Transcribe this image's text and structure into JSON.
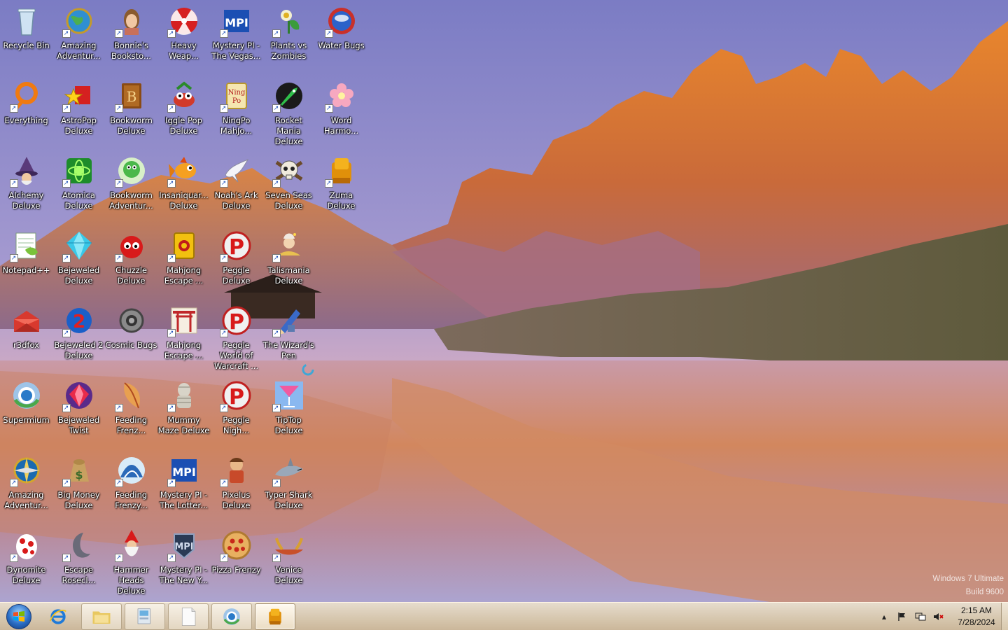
{
  "desktop": {
    "icons": [
      {
        "label": "Recycle Bin",
        "icon": "recycle-bin-icon",
        "shortcut": false
      },
      {
        "label": "Amazing Adventur...",
        "icon": "globe-icon",
        "shortcut": true
      },
      {
        "label": "Bonnie's Booksto...",
        "icon": "character-icon",
        "shortcut": true
      },
      {
        "label": "Heavy Weap...",
        "icon": "radiation-icon",
        "shortcut": true
      },
      {
        "label": "Mystery PI - The Vegas...",
        "icon": "mpi-icon",
        "shortcut": true
      },
      {
        "label": "Plants vs Zombies",
        "icon": "plant-icon",
        "shortcut": true
      },
      {
        "label": "Water Bugs",
        "icon": "orb-icon",
        "shortcut": true
      },
      {
        "label": "Everything",
        "icon": "magnifier-icon",
        "shortcut": true
      },
      {
        "label": "AstroPop Deluxe",
        "icon": "star-icon",
        "shortcut": true
      },
      {
        "label": "Bookworm Deluxe",
        "icon": "book-icon",
        "shortcut": true
      },
      {
        "label": "Iggle Pop Deluxe",
        "icon": "creature-icon",
        "shortcut": true
      },
      {
        "label": "NingPo MahJo...",
        "icon": "mahjong-tile-icon",
        "shortcut": true
      },
      {
        "label": "Rocket Mania Deluxe",
        "icon": "rocket-icon",
        "shortcut": true
      },
      {
        "label": "Word Harmo...",
        "icon": "flower-icon",
        "shortcut": true
      },
      {
        "label": "Alchemy Deluxe",
        "icon": "wizard-icon",
        "shortcut": true
      },
      {
        "label": "Atomica Deluxe",
        "icon": "atom-icon",
        "shortcut": true
      },
      {
        "label": "Bookworm Adventur...",
        "icon": "worm-icon",
        "shortcut": true
      },
      {
        "label": "Insaniquar... Deluxe",
        "icon": "fish-icon",
        "shortcut": true
      },
      {
        "label": "Noah's Ark Deluxe",
        "icon": "dove-icon",
        "shortcut": true
      },
      {
        "label": "Seven Seas Deluxe",
        "icon": "skull-icon",
        "shortcut": true
      },
      {
        "label": "Zuma Deluxe",
        "icon": "frog-idol-icon",
        "shortcut": true
      },
      {
        "label": "Notepad++",
        "icon": "notepad-icon",
        "shortcut": true
      },
      {
        "label": "Bejeweled Deluxe",
        "icon": "gem-icon",
        "shortcut": true
      },
      {
        "label": "Chuzzle Deluxe",
        "icon": "chuzzle-icon",
        "shortcut": true
      },
      {
        "label": "Mahjong Escape ...",
        "icon": "scroll-icon",
        "shortcut": true
      },
      {
        "label": "Peggle Deluxe",
        "icon": "peggle-icon",
        "shortcut": true
      },
      {
        "label": "Talismania Deluxe",
        "icon": "genie-icon",
        "shortcut": true
      },
      {
        "label": "r3dfox",
        "icon": "fox-icon",
        "shortcut": false
      },
      {
        "label": "Bejeweled 2 Deluxe",
        "icon": "gem2-icon",
        "shortcut": true
      },
      {
        "label": "Cosmic Bugs",
        "icon": "bug-icon",
        "shortcut": false
      },
      {
        "label": "Mahjong Escape ...",
        "icon": "torii-icon",
        "shortcut": true
      },
      {
        "label": "Peggle World of Warcraft ...",
        "icon": "peggle-icon",
        "shortcut": true
      },
      {
        "label": "The Wizard's Pen",
        "icon": "pen-icon",
        "shortcut": true
      },
      {
        "label": "Supermium",
        "icon": "browser-icon",
        "shortcut": false
      },
      {
        "label": "Bejeweled Twist",
        "icon": "twist-icon",
        "shortcut": true
      },
      {
        "label": "Feeding Frenz...",
        "icon": "feeding-fish-icon",
        "shortcut": true
      },
      {
        "label": "Mummy Maze Deluxe",
        "icon": "mummy-icon",
        "shortcut": true
      },
      {
        "label": "Peggle Nigh...",
        "icon": "peggle-icon",
        "shortcut": true
      },
      {
        "label": "TipTop Deluxe",
        "icon": "cocktail-icon",
        "shortcut": true
      },
      {
        "label": "Amazing Adventur...",
        "icon": "compass-icon",
        "shortcut": true
      },
      {
        "label": "Big Money Deluxe",
        "icon": "money-bag-icon",
        "shortcut": true
      },
      {
        "label": "Feeding Frenzy...",
        "icon": "shark-fin-icon",
        "shortcut": true
      },
      {
        "label": "Mystery PI - The Lotter...",
        "icon": "mpi-icon",
        "shortcut": true
      },
      {
        "label": "Pixelus Deluxe",
        "icon": "explorer-icon",
        "shortcut": true
      },
      {
        "label": "Typer Shark Deluxe",
        "icon": "shark-icon",
        "shortcut": true
      },
      {
        "label": "Dynomite Deluxe",
        "icon": "egg-icon",
        "shortcut": true
      },
      {
        "label": "Escape Rosecl...",
        "icon": "moon-icon",
        "shortcut": true
      },
      {
        "label": "Hammer Heads Deluxe",
        "icon": "gnome-icon",
        "shortcut": true
      },
      {
        "label": "Mystery PI - The New Y...",
        "icon": "mpi-badge-icon",
        "shortcut": true
      },
      {
        "label": "Pizza Frenzy",
        "icon": "pizza-icon",
        "shortcut": true
      },
      {
        "label": "Venice Deluxe",
        "icon": "gondola-icon",
        "shortcut": true
      }
    ]
  },
  "watermark": {
    "line1": "Windows 7 Ultimate",
    "line2": "Build 9600"
  },
  "taskbar": {
    "buttons": [
      {
        "name": "internet-explorer",
        "icon": "ie-icon",
        "state": "plain"
      },
      {
        "name": "file-explorer",
        "icon": "folder-icon",
        "state": "pinned"
      },
      {
        "name": "control-panel",
        "icon": "control-panel-icon",
        "state": "pinned"
      },
      {
        "name": "blank-document",
        "icon": "document-icon",
        "state": "pinned"
      },
      {
        "name": "supermium",
        "icon": "browser-icon",
        "state": "pinned"
      },
      {
        "name": "zuma-deluxe",
        "icon": "frog-idol-icon",
        "state": "active"
      }
    ],
    "tray": {
      "icons": [
        "show-hidden-icons-icon",
        "flag-icon",
        "network-icon",
        "volume-muted-icon"
      ],
      "time": "2:15 AM",
      "date": "7/28/2024"
    }
  },
  "colors": {
    "taskbar_top": "#e6dccd",
    "taskbar_bottom": "#cbb79a",
    "label_text": "#ffffff"
  }
}
